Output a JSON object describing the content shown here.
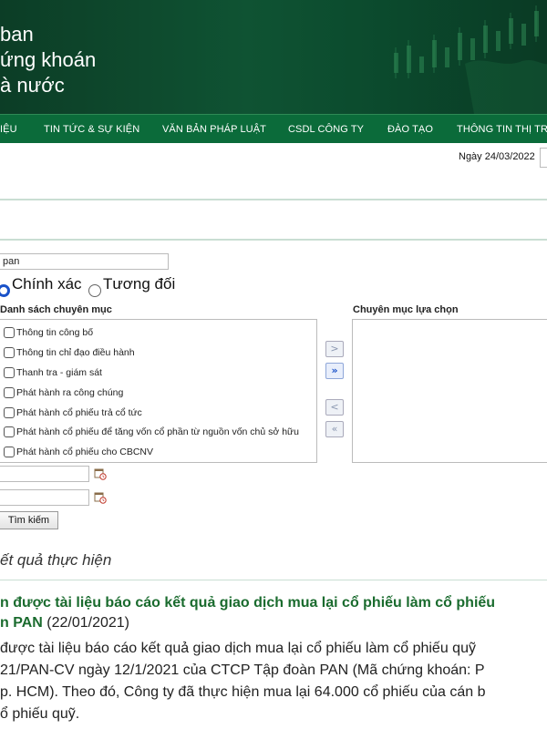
{
  "banner": {
    "title_lines": [
      "ban",
      "ứng khoán",
      "à nước"
    ]
  },
  "nav": {
    "items": [
      "IỆU",
      "TIN TỨC & SỰ KIỆN",
      "VĂN BẢN PHÁP LUẬT",
      "CSDL CÔNG TY",
      "ĐÀO TẠO",
      "THÔNG TIN THỊ TR"
    ]
  },
  "date_text": "Ngày 24/03/2022",
  "search": {
    "value": "pan",
    "mode_options": [
      "Chính xác",
      "Tương đối"
    ],
    "mode_selected": "Chính xác"
  },
  "categories": {
    "header": "Danh sách chuyên mục",
    "items": [
      "Thông tin công bố",
      "Thông tin chỉ đạo điều hành",
      "Thanh tra - giám sát",
      "Phát hành ra công chúng",
      "Phát hành cổ phiếu trả cổ tức",
      "Phát hành cổ phiếu để tăng vốn cổ phần từ nguồn vốn chủ sở hữu",
      "Phát hành cổ phiếu cho CBCNV"
    ]
  },
  "selected": {
    "header": "Chuyên mục lựa chọn"
  },
  "move_buttons": [
    ">",
    "»",
    "<",
    "«"
  ],
  "search_button": "Tìm kiếm",
  "results": {
    "title": "ết quả thực hiện",
    "item_title_line1": "n được tài liệu báo cáo kết quả giao dịch mua lại cổ phiếu làm cổ phiếu",
    "item_title_line2": "n PAN",
    "item_date": " (22/01/2021)",
    "body_lines": [
      " được tài liệu báo cáo kết quả giao dịch mua lại cổ phiếu làm cổ phiếu quỹ",
      "21/PAN-CV ngày 12/1/2021 của CTCP Tập đoàn PAN (Mã chứng khoán: P",
      "p. HCM). Theo đó, Công ty đã thực hiện mua lại 64.000 cổ phiếu của cán b",
      "ổ phiếu quỹ."
    ]
  }
}
